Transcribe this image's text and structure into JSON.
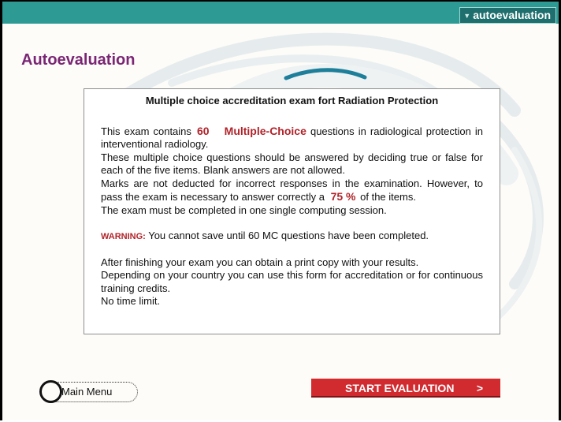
{
  "topbar": {
    "section_tab": "autoevaluation",
    "tab_icon": "triangle-down-icon"
  },
  "page": {
    "title": "Autoevaluation"
  },
  "panel": {
    "title": "Multiple choice accreditation exam fort Radiation Protection",
    "p1": {
      "pre": "This exam contains",
      "count": "60",
      "kind": "Multiple-Choice",
      "post": "questions in radiological protection in interventional radiology."
    },
    "p2": "These multiple choice questions should be answered by deciding true or false for each of the five items. Blank answers are not allowed.",
    "p3": {
      "pre": "Marks are not deducted for incorrect responses in the examination. However, to pass the exam is necessary to answer correctly a",
      "percent": "75 %",
      "post": "of the items."
    },
    "p4": "The exam must be completed in one single computing session.",
    "warning": {
      "label": "WARNING:",
      "text": "You cannot save until 60 MC questions have been completed."
    },
    "p5": "After finishing your exam you can obtain a print copy with your results.",
    "p6": "Depending on your country you can use this form for accreditation or for continuous training credits.",
    "p7": "No time limit."
  },
  "buttons": {
    "main_menu": "Main Menu",
    "start": "START EVALUATION",
    "start_arrow": ">"
  },
  "colors": {
    "topbar": "#2e9a94",
    "title": "#7a2674",
    "accent_red": "#d12a2f",
    "swoosh_teal": "#1e7f9a"
  }
}
